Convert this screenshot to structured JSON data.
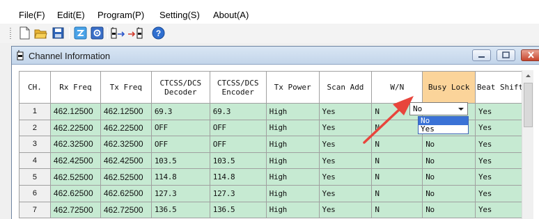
{
  "menu": {
    "file": "File(F)",
    "edit": "Edit(E)",
    "program": "Program(P)",
    "setting": "Setting(S)",
    "about": "About(A)"
  },
  "toolbar": {
    "icons": [
      "new-file-icon",
      "open-folder-icon",
      "save-icon",
      "write-radio-icon",
      "settings-icon",
      "read-from-radio-icon",
      "write-to-radio-icon",
      "help-icon"
    ]
  },
  "window": {
    "title": "Channel Information"
  },
  "table": {
    "columns": [
      "CH.",
      "Rx Freq",
      "Tx Freq",
      "CTCSS/DCS Decoder",
      "CTCSS/DCS Encoder",
      "Tx Power",
      "Scan Add",
      "W/N",
      "Busy Lock",
      "Beat Shift"
    ],
    "rows": [
      {
        "ch": "1",
        "rx": "462.12500",
        "tx": "462.12500",
        "dec": "69.3",
        "enc": "69.3",
        "power": "High",
        "scan": "Yes",
        "wn": "N",
        "busy": "",
        "beat": "Yes"
      },
      {
        "ch": "2",
        "rx": "462.22500",
        "tx": "462.22500",
        "dec": "OFF",
        "enc": "OFF",
        "power": "High",
        "scan": "Yes",
        "wn": "N",
        "busy": "",
        "beat": "Yes"
      },
      {
        "ch": "3",
        "rx": "462.32500",
        "tx": "462.32500",
        "dec": "OFF",
        "enc": "OFF",
        "power": "High",
        "scan": "Yes",
        "wn": "N",
        "busy": "No",
        "beat": "Yes"
      },
      {
        "ch": "4",
        "rx": "462.42500",
        "tx": "462.42500",
        "dec": "103.5",
        "enc": "103.5",
        "power": "High",
        "scan": "Yes",
        "wn": "N",
        "busy": "No",
        "beat": "Yes"
      },
      {
        "ch": "5",
        "rx": "462.52500",
        "tx": "462.52500",
        "dec": "114.8",
        "enc": "114.8",
        "power": "High",
        "scan": "Yes",
        "wn": "N",
        "busy": "No",
        "beat": "Yes"
      },
      {
        "ch": "6",
        "rx": "462.62500",
        "tx": "462.62500",
        "dec": "127.3",
        "enc": "127.3",
        "power": "High",
        "scan": "Yes",
        "wn": "N",
        "busy": "No",
        "beat": "Yes"
      },
      {
        "ch": "7",
        "rx": "462.72500",
        "tx": "462.72500",
        "dec": "136.5",
        "enc": "136.5",
        "power": "High",
        "scan": "Yes",
        "wn": "N",
        "busy": "No",
        "beat": "Yes"
      }
    ]
  },
  "busy_lock_editor": {
    "value": "No",
    "options": [
      "No",
      "Yes"
    ]
  },
  "colors": {
    "row_bg": "#c6ead2",
    "highlight_header": "#fbd49a",
    "annotation": "#e8453c",
    "selection": "#3a72d6"
  }
}
